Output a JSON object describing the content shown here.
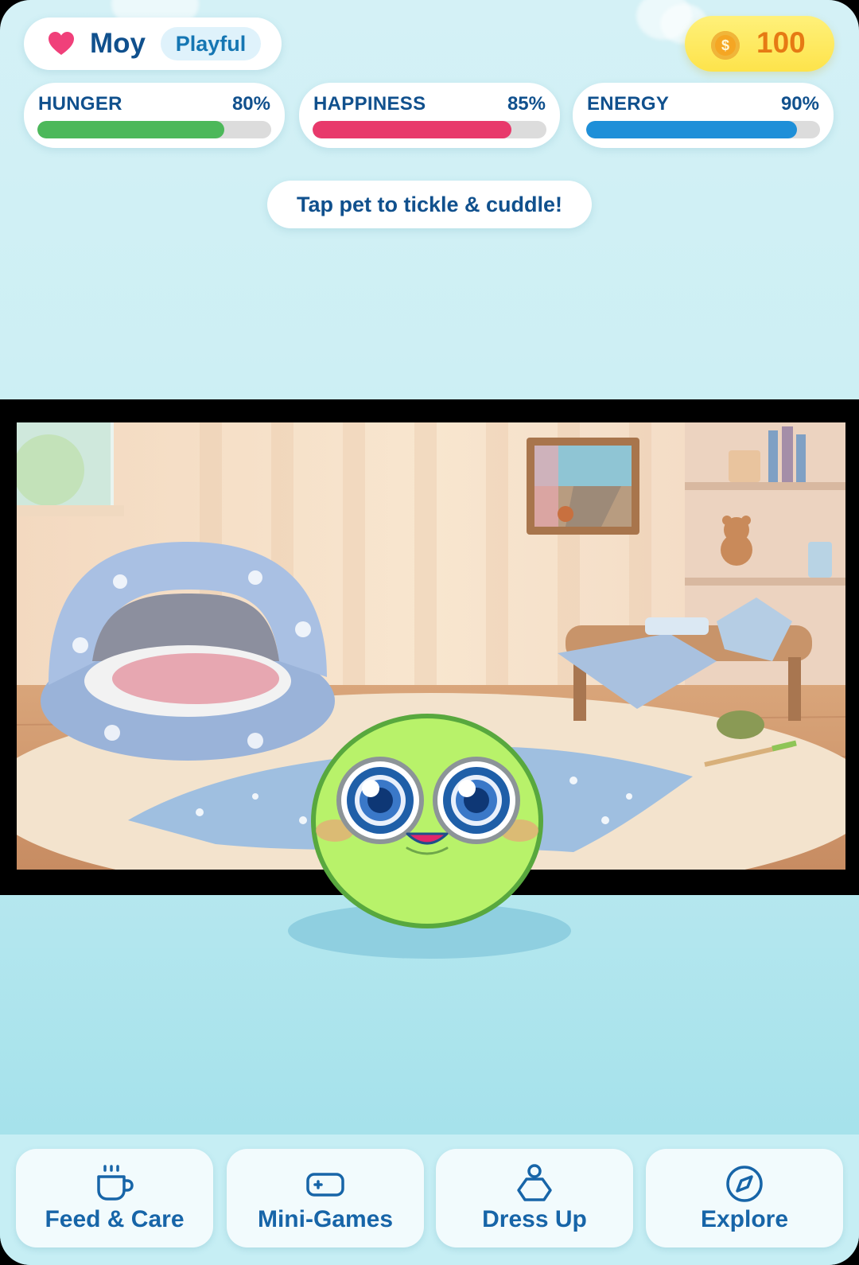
{
  "pet": {
    "name": "Moy",
    "mood": "Playful"
  },
  "coins": {
    "icon": "coin-icon",
    "symbol": "$",
    "count": "100"
  },
  "stats": [
    {
      "label": "HUNGER",
      "value_text": "80%",
      "value": 0.8,
      "color": "#4cb85a"
    },
    {
      "label": "HAPPINESS",
      "value_text": "85%",
      "value": 0.85,
      "color": "#e8396b"
    },
    {
      "label": "ENERGY",
      "value_text": "90%",
      "value": 0.9,
      "color": "#1e8fd8"
    }
  ],
  "hint": "Tap pet to tickle & cuddle!",
  "nav": [
    {
      "label": "Feed & Care",
      "icon": "cup-icon"
    },
    {
      "label": "Mini-Games",
      "icon": "gamepad-icon"
    },
    {
      "label": "Dress Up",
      "icon": "shirt-icon"
    },
    {
      "label": "Explore",
      "icon": "compass-icon"
    }
  ],
  "colors": {
    "pet_body": "#b8f26a",
    "pet_outline": "#58a83e",
    "heart": "#f0407a",
    "coin": "#f5a623",
    "accent_text": "#10508d"
  }
}
